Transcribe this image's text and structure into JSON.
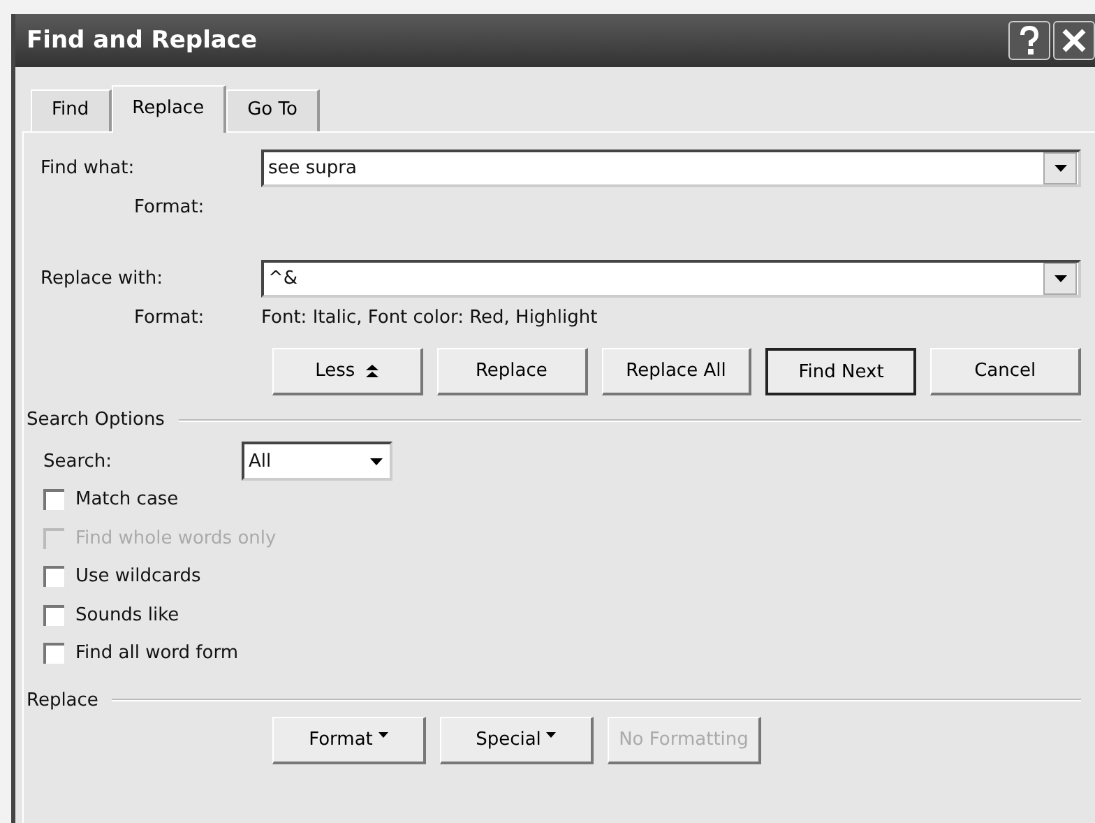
{
  "window": {
    "title": "Find and Replace"
  },
  "tabs": [
    {
      "label": "Find",
      "selected": false
    },
    {
      "label": "Replace",
      "selected": true
    },
    {
      "label": "Go To",
      "selected": false
    }
  ],
  "find": {
    "label": "Find what:",
    "value": "see supra",
    "format_label": "Format:"
  },
  "replace": {
    "label": "Replace with:",
    "value": "^&",
    "format_label": "Format:",
    "format": "Font: Italic, Font color: Red, Highlight"
  },
  "buttons": [
    {
      "label": "Less",
      "kind": "less",
      "default": false
    },
    {
      "label": "Replace",
      "kind": "plain",
      "default": false
    },
    {
      "label": "Replace All",
      "kind": "plain",
      "default": false
    },
    {
      "label": "Find Next",
      "kind": "plain",
      "default": true
    },
    {
      "label": "Cancel",
      "kind": "plain",
      "default": false
    }
  ],
  "search_options": {
    "heading": "Search Options",
    "search_label": "Search:",
    "search_value": "All",
    "options": [
      {
        "label": "Match case",
        "checked": false,
        "disabled": false
      },
      {
        "label": "Find whole words only",
        "checked": false,
        "disabled": true
      },
      {
        "label": "Use wildcards",
        "checked": false,
        "disabled": false
      },
      {
        "label": "Sounds like",
        "checked": false,
        "disabled": false
      },
      {
        "label": "Find all word form",
        "checked": false,
        "disabled": false
      }
    ]
  },
  "replace_section": {
    "heading": "Replace",
    "buttons": [
      {
        "label": "Format",
        "menu": true,
        "disabled": false
      },
      {
        "label": "Special",
        "menu": true,
        "disabled": false
      },
      {
        "label": "No Formatting",
        "menu": false,
        "disabled": true
      }
    ]
  }
}
